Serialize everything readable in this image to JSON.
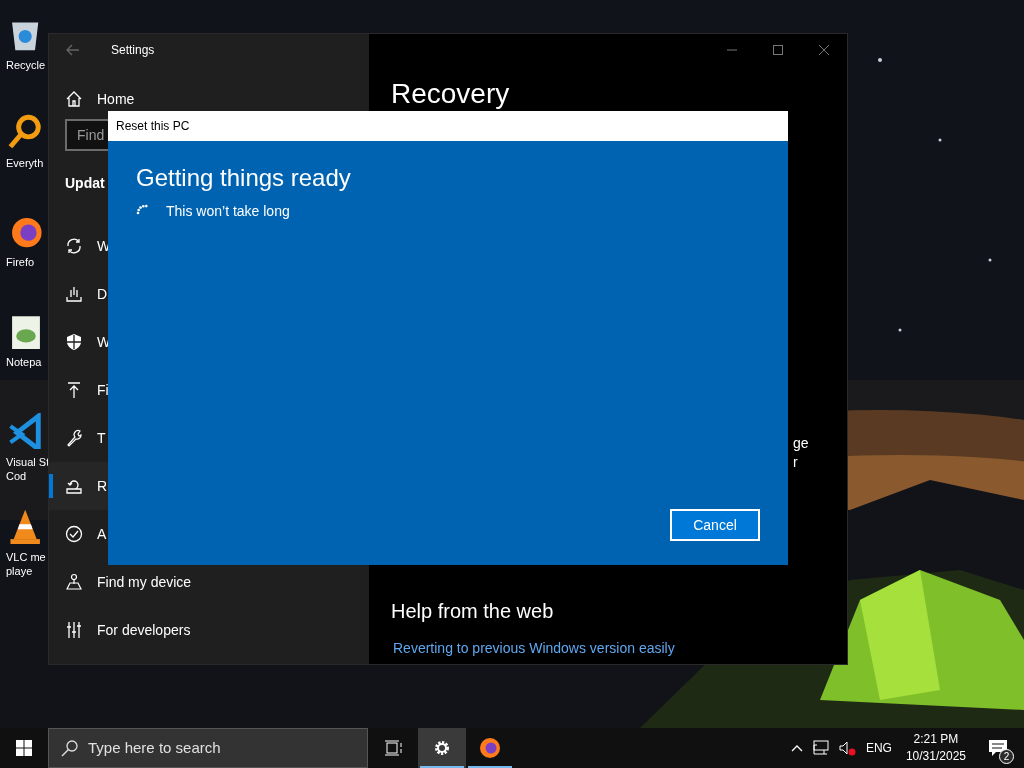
{
  "desktop_icons": [
    {
      "kind": "recycle",
      "lines": [
        "Recycle"
      ]
    },
    {
      "kind": "search",
      "lines": [
        "Everyth"
      ]
    },
    {
      "kind": "firefox",
      "lines": [
        "Firefo"
      ]
    },
    {
      "kind": "notepad",
      "lines": [
        "Notepa"
      ]
    },
    {
      "kind": "vscode",
      "lines": [
        "Visual St",
        "Cod"
      ]
    },
    {
      "kind": "vlc",
      "lines": [
        "VLC me",
        "playe"
      ]
    }
  ],
  "settings": {
    "title": "Settings",
    "home": "Home",
    "search": {
      "placeholder": "Find"
    },
    "section": "Updat",
    "nav": [
      {
        "label": "W",
        "selected": false
      },
      {
        "label": "D",
        "selected": false
      },
      {
        "label": "W",
        "selected": false
      },
      {
        "label": "Fi",
        "selected": false
      },
      {
        "label": "T",
        "selected": false
      },
      {
        "label": "R",
        "selected": true
      },
      {
        "label": "A",
        "selected": false
      },
      {
        "label": "Find my device",
        "selected": false
      },
      {
        "label": "For developers",
        "selected": false
      }
    ],
    "page_title": "Recovery",
    "fragments": [
      "ge",
      "r"
    ],
    "help_heading": "Help from the web",
    "help_link": "Reverting to previous Windows version easily"
  },
  "dialog": {
    "title": "Reset this PC",
    "heading": "Getting things ready",
    "message": "This won’t take long",
    "button": "Cancel"
  },
  "taskbar": {
    "search": {
      "placeholder": "Type here to search"
    },
    "apps": [
      {
        "selected": true,
        "running": true
      },
      {
        "selected": false,
        "running": true
      }
    ],
    "language": "ENG",
    "time": "2:21 PM",
    "date": "10/31/2025",
    "notifications": "2"
  }
}
